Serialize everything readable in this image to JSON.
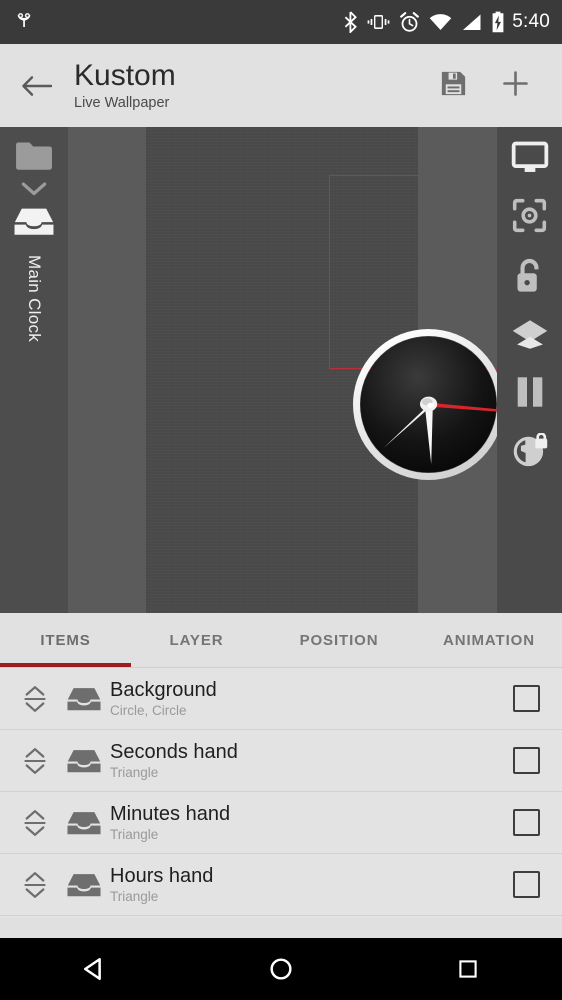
{
  "statusbar": {
    "time": "5:40",
    "icons": [
      "owl-logo-icon",
      "bluetooth-icon",
      "vibrate-icon",
      "alarm-icon",
      "wifi-icon",
      "signal-icon",
      "battery-charging-icon"
    ],
    "background": "#3a3a3a",
    "foreground": "#ffffff"
  },
  "appbar": {
    "back_label": "back-arrow",
    "title": "Kustom",
    "subtitle": "Live Wallpaper",
    "actions": [
      "save-icon",
      "add-icon"
    ],
    "background": "#e1e1e1"
  },
  "editor": {
    "left_rail": {
      "icons": [
        "folder-icon",
        "chevron-down-icon",
        "tray-icon"
      ],
      "label": "Main Clock"
    },
    "right_rail": {
      "icons": [
        "monitor-icon",
        "center-focus-icon",
        "unlock-icon",
        "layers-icon",
        "pause-icon",
        "globe-lock-icon"
      ]
    },
    "preview": {
      "selection_color": "#b8303a",
      "wallpaper_color": "#4a4a4a",
      "widget_name": "analog-clock"
    }
  },
  "tabs": {
    "active": "ITEMS",
    "accent": "#9c1c22",
    "items": [
      {
        "label": "ITEMS"
      },
      {
        "label": "LAYER"
      },
      {
        "label": "POSITION"
      },
      {
        "label": "ANIMATION"
      }
    ]
  },
  "list": {
    "rows": [
      {
        "title": "Background",
        "subtitle": "Circle, Circle",
        "checked": false
      },
      {
        "title": "Seconds hand",
        "subtitle": "Triangle",
        "checked": false
      },
      {
        "title": "Minutes hand",
        "subtitle": "Triangle",
        "checked": false
      },
      {
        "title": "Hours hand",
        "subtitle": "Triangle",
        "checked": false
      }
    ]
  },
  "navbar": {
    "buttons": [
      "back-triangle-icon",
      "home-circle-icon",
      "recents-square-icon"
    ],
    "background": "#000000"
  }
}
